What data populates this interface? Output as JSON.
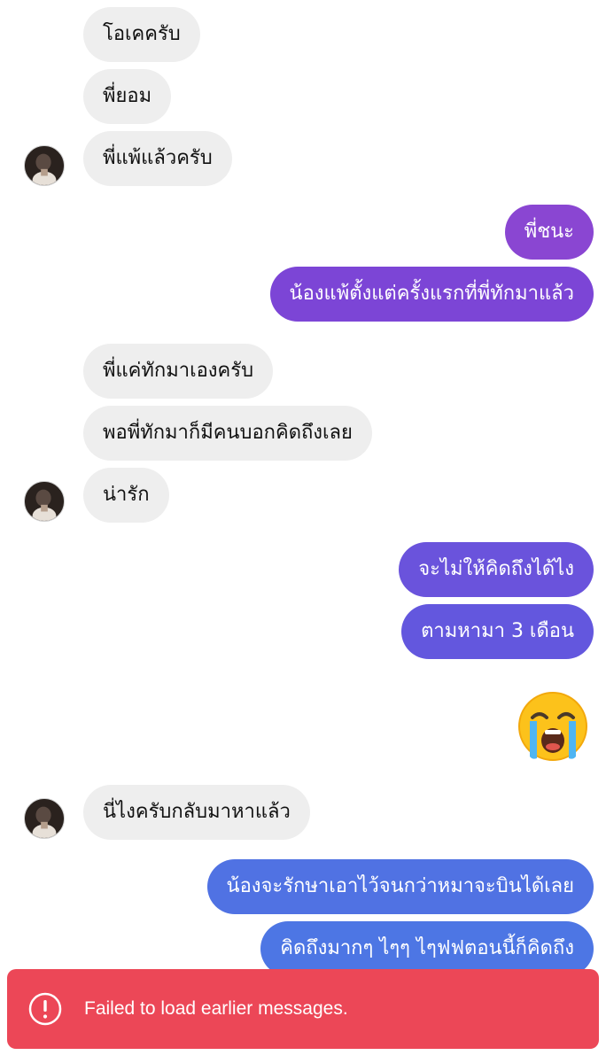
{
  "colors": {
    "incoming_bubble": "#eeeeee",
    "outgoing_gradient": [
      "#8a46d2",
      "#7c45d6",
      "#6a53dc",
      "#5c62e0",
      "#4f72e3"
    ],
    "toast_background": "#ec4757"
  },
  "messages": [
    {
      "side": "incoming",
      "text": "โอเคครับ"
    },
    {
      "side": "incoming",
      "text": "พี่ยอม"
    },
    {
      "side": "incoming",
      "text": "พี่แพ้แล้วครับ"
    },
    {
      "side": "outgoing",
      "text": "พี่ชนะ"
    },
    {
      "side": "outgoing",
      "text": "น้องแพ้ตั้งแต่ครั้งแรกที่พี่ทักมาแล้ว"
    },
    {
      "side": "incoming",
      "text": "พี่แค่ทักมาเองครับ"
    },
    {
      "side": "incoming",
      "text": "พอพี่ทักมาก็มีคนบอกคิดถึงเลย"
    },
    {
      "side": "incoming",
      "text": "น่ารัก"
    },
    {
      "side": "outgoing",
      "text": "จะไม่ให้คิดถึงได้ไง"
    },
    {
      "side": "outgoing",
      "text": "ตามหามา 3 เดือน"
    },
    {
      "side": "outgoing",
      "emoji": "loudly-crying-face-emoji"
    },
    {
      "side": "incoming",
      "text": "นี่ไงครับกลับมาหาแล้ว"
    },
    {
      "side": "outgoing",
      "text": "น้องจะรักษาเอาไว้จนกว่าหมาจะบินได้เลย"
    },
    {
      "side": "outgoing",
      "text": "คิดถึงมากๆ ไๆๆ ไๆฟฟตอนนี้ก็คิดถึง"
    }
  ],
  "toast": {
    "icon": "alert-circle-icon",
    "message": "Failed to load earlier messages."
  }
}
